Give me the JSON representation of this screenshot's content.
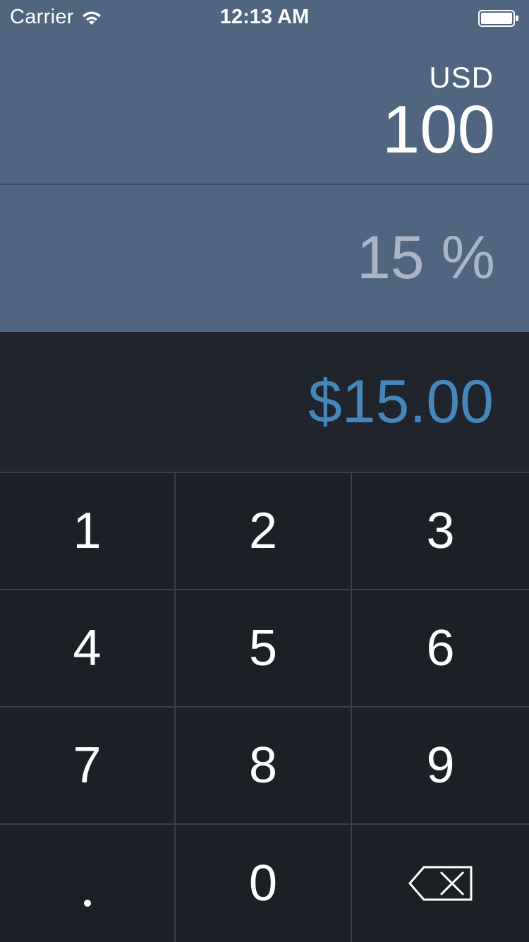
{
  "status_bar": {
    "carrier": "Carrier",
    "time": "12:13 AM",
    "wifi_icon": "wifi-icon",
    "battery_icon": "battery-icon"
  },
  "amount": {
    "currency": "USD",
    "value": "100"
  },
  "tip": {
    "percent": "15 %"
  },
  "result": {
    "value": "$15.00"
  },
  "keypad": {
    "keys": [
      "1",
      "2",
      "3",
      "4",
      "5",
      "6",
      "7",
      "8",
      "9",
      ".",
      "0"
    ],
    "backspace_icon": "backspace-icon"
  },
  "colors": {
    "header_bg": "#4f6580",
    "result_bg": "#1f242d",
    "keypad_bg": "#1b1f26",
    "result_text": "#4686b8",
    "percent_text": "#aab6c8"
  }
}
